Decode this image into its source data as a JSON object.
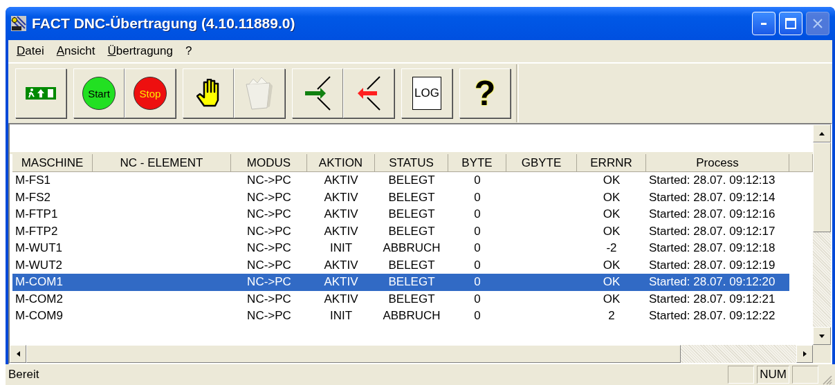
{
  "window": {
    "title": "FACT DNC-Übertragung (4.10.11889.0)",
    "controls": [
      {
        "kind": "minimize",
        "disabled": false
      },
      {
        "kind": "maximize",
        "disabled": false
      },
      {
        "kind": "close",
        "disabled": true
      }
    ]
  },
  "menu": [
    "Datei",
    "Ansicht",
    "Übertragung",
    "?"
  ],
  "toolbar": [
    {
      "kind": "exit",
      "disabled": false
    },
    {
      "kind": "start",
      "label": "Start",
      "disabled": false
    },
    {
      "kind": "stop",
      "label": "Stop",
      "disabled": false
    },
    {
      "kind": "hand",
      "disabled": false
    },
    {
      "kind": "trash",
      "disabled": true
    },
    {
      "kind": "receive",
      "disabled": false
    },
    {
      "kind": "send",
      "disabled": false
    },
    {
      "kind": "log",
      "label": "LOG",
      "disabled": false
    },
    {
      "kind": "help",
      "label": "?",
      "disabled": false
    }
  ],
  "table": {
    "columns": [
      "MASCHINE",
      "NC - ELEMENT",
      "MODUS",
      "AKTION",
      "STATUS",
      "BYTE",
      "GBYTE",
      "ERRNR",
      "Process"
    ],
    "rows": [
      {
        "cells": [
          "M-FS1",
          "",
          "NC->PC",
          "AKTIV",
          "BELEGT",
          "0",
          "",
          "OK",
          "Started: 28.07. 09:12:13"
        ],
        "selected": false
      },
      {
        "cells": [
          "M-FS2",
          "",
          "NC->PC",
          "AKTIV",
          "BELEGT",
          "0",
          "",
          "OK",
          "Started: 28.07. 09:12:14"
        ],
        "selected": false
      },
      {
        "cells": [
          "M-FTP1",
          "",
          "NC->PC",
          "AKTIV",
          "BELEGT",
          "0",
          "",
          "OK",
          "Started: 28.07. 09:12:16"
        ],
        "selected": false
      },
      {
        "cells": [
          "M-FTP2",
          "",
          "NC->PC",
          "AKTIV",
          "BELEGT",
          "0",
          "",
          "OK",
          "Started: 28.07. 09:12:17"
        ],
        "selected": false
      },
      {
        "cells": [
          "M-WUT1",
          "",
          "NC->PC",
          "INIT",
          "ABBRUCH",
          "0",
          "",
          "-2",
          "Started: 28.07. 09:12:18"
        ],
        "selected": false
      },
      {
        "cells": [
          "M-WUT2",
          "",
          "NC->PC",
          "AKTIV",
          "BELEGT",
          "0",
          "",
          "OK",
          "Started: 28.07. 09:12:19"
        ],
        "selected": false
      },
      {
        "cells": [
          "M-COM1",
          "",
          "NC->PC",
          "AKTIV",
          "BELEGT",
          "0",
          "",
          "OK",
          "Started: 28.07. 09:12:20"
        ],
        "selected": true
      },
      {
        "cells": [
          "M-COM2",
          "",
          "NC->PC",
          "AKTIV",
          "BELEGT",
          "0",
          "",
          "OK",
          "Started: 28.07. 09:12:21"
        ],
        "selected": false
      },
      {
        "cells": [
          "M-COM9",
          "",
          "NC->PC",
          "INIT",
          "ABBRUCH",
          "0",
          "",
          "2",
          "Started: 28.07. 09:12:22"
        ],
        "selected": false
      }
    ]
  },
  "status_bar": {
    "message": "Bereit",
    "indicator": "NUM"
  }
}
